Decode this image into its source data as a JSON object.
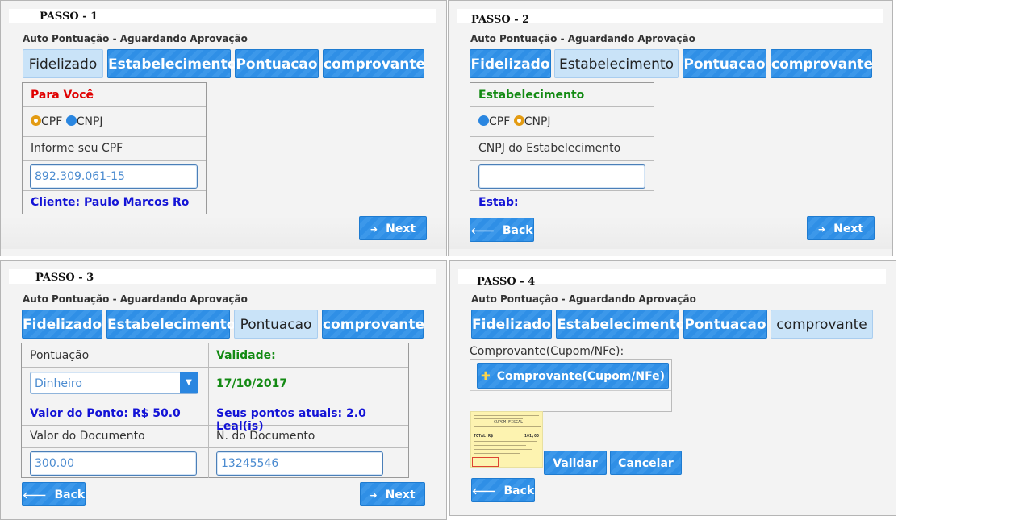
{
  "p1": {
    "passo": "PASSO - 1",
    "subtitle": "Auto Pontuação - Aguardando Aprovação",
    "tabs": [
      "Fidelizado",
      "Estabelecimento",
      "Pontuacao",
      "comprovante"
    ],
    "heading": "Para Você",
    "radio_cpf": "CPF",
    "radio_cnpj": "CNPJ",
    "label": "Informe seu CPF",
    "input_value": "892.309.061-15",
    "client": "Cliente: Paulo Marcos Ro",
    "next": "Next"
  },
  "p2": {
    "passo": "PASSO - 2",
    "subtitle": "Auto Pontuação - Aguardando Aprovação",
    "tabs": [
      "Fidelizado",
      "Estabelecimento",
      "Pontuacao",
      "comprovante"
    ],
    "heading": "Estabelecimento",
    "radio_cpf": "CPF",
    "radio_cnpj": "CNPJ",
    "label": "CNPJ do Estabelecimento",
    "input_value": "",
    "estab": "Estab:",
    "back": "Back",
    "next": "Next"
  },
  "p3": {
    "passo": "PASSO - 3",
    "subtitle": "Auto Pontuação - Aguardando Aprovação",
    "tabs": [
      "Fidelizado",
      "Estabelecimento",
      "Pontuacao",
      "comprovante"
    ],
    "pontuacao_label": "Pontuação",
    "validade_label": "Validade:",
    "select_value": "Dinheiro",
    "validade_value": "17/10/2017",
    "valor_ponto": "Valor do Ponto: R$ 50.0",
    "pontos_atuais": "Seus pontos atuais: 2.0 Leal(is)",
    "valor_doc_label": "Valor do Documento",
    "num_doc_label": "N. do Documento",
    "valor_doc_value": "300.00",
    "num_doc_value": "13245546",
    "back": "Back",
    "next": "Next"
  },
  "p4": {
    "passo": "PASSO - 4",
    "subtitle": "Auto Pontuação - Aguardando Aprovação",
    "tabs": [
      "Fidelizado",
      "Estabelecimento",
      "Pontuacao",
      "comprovante"
    ],
    "comprovante_label": "Comprovante(Cupom/NFe):",
    "add_button": "Comprovante(Cupom/NFe)",
    "receipt_title": "CUPOM FISCAL",
    "receipt_total_label": "TOTAL R$",
    "receipt_total": "101,00",
    "validar": "Validar",
    "cancelar": "Cancelar",
    "back": "Back"
  },
  "icons": {
    "next": "arrow-right-icon",
    "back": "arrow-left-icon",
    "add": "plus-icon",
    "dropdown": "chevron-down-icon"
  },
  "colors": {
    "accent": "#2f8fe6",
    "active_tab": "#c9e3f8",
    "red": "#e00000",
    "green": "#138a13",
    "blue": "#1313d6",
    "radio_selected": "#e39b12"
  }
}
